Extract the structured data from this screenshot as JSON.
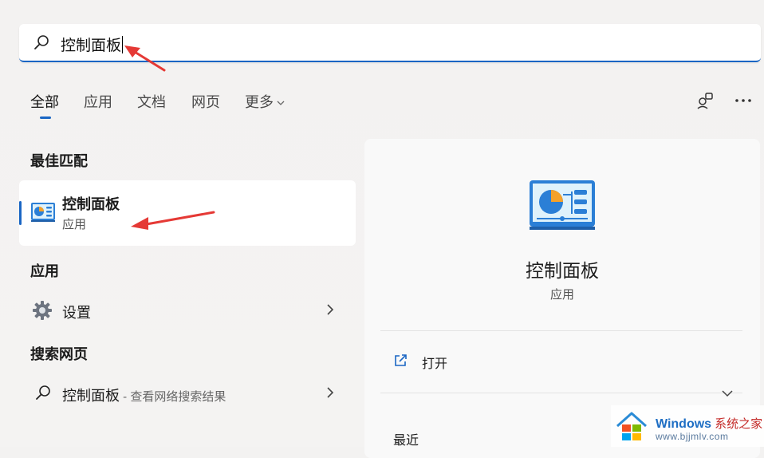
{
  "search": {
    "value": "控制面板"
  },
  "tabs": [
    {
      "label": "全部",
      "active": true
    },
    {
      "label": "应用"
    },
    {
      "label": "文档"
    },
    {
      "label": "网页"
    },
    {
      "label": "更多"
    }
  ],
  "toolbar": {
    "icons": [
      "switch-account-icon",
      "more-options-icon"
    ]
  },
  "best_match": {
    "section_title": "最佳匹配",
    "title": "控制面板",
    "subtitle": "应用"
  },
  "apps": {
    "section_title": "应用",
    "items": [
      {
        "label": "设置",
        "icon": "gear-icon"
      }
    ]
  },
  "web": {
    "section_title": "搜索网页",
    "items": [
      {
        "label": "控制面板",
        "sub": " - 查看网络搜索结果",
        "icon": "search-icon"
      }
    ]
  },
  "detail": {
    "title": "控制面板",
    "subtitle": "应用",
    "open_label": "打开",
    "recent_label": "最近"
  },
  "watermark": {
    "brand": "Windows",
    "cn": "系统之家",
    "url": "www.bjjmlv.com"
  },
  "colors": {
    "accent": "#1a66c4",
    "annotation_arrow": "#e53935"
  }
}
